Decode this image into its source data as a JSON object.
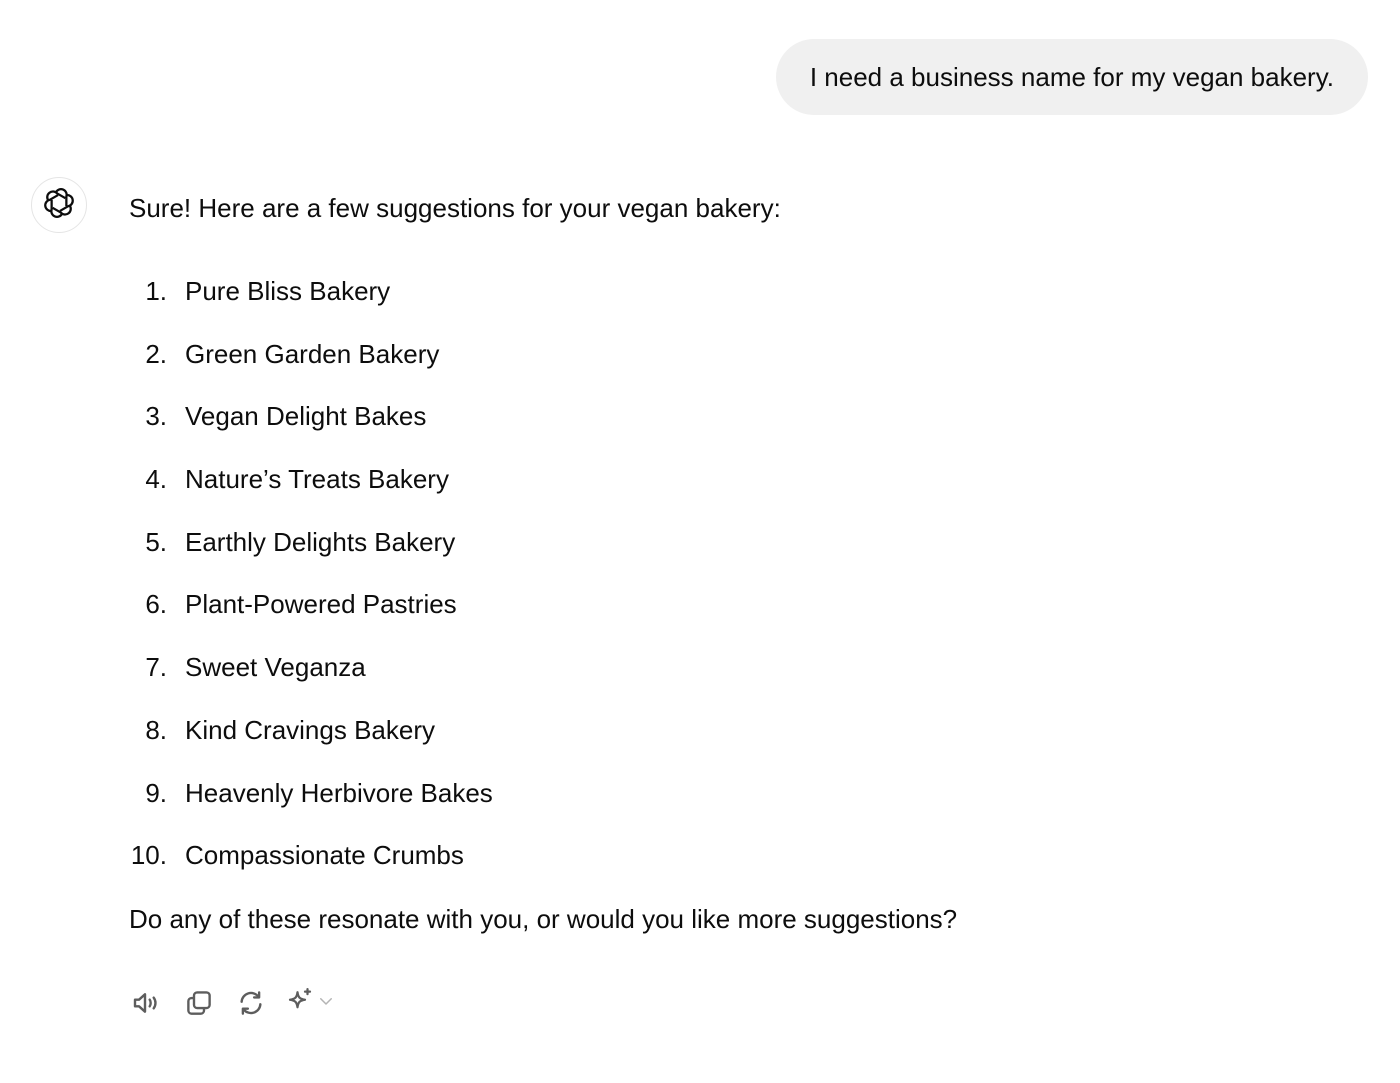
{
  "conversation": {
    "user_message": "I need a business name for my vegan bakery.",
    "assistant": {
      "avatar_icon": "openai-logo-icon",
      "intro": "Sure! Here are a few suggestions for your vegan bakery:",
      "suggestions": [
        {
          "num": "1.",
          "text": "Pure Bliss Bakery"
        },
        {
          "num": "2.",
          "text": "Green Garden Bakery"
        },
        {
          "num": "3.",
          "text": "Vegan Delight Bakes"
        },
        {
          "num": "4.",
          "text": "Nature’s Treats Bakery"
        },
        {
          "num": "5.",
          "text": "Earthly Delights Bakery"
        },
        {
          "num": "6.",
          "text": "Plant-Powered Pastries"
        },
        {
          "num": "7.",
          "text": "Sweet Veganza"
        },
        {
          "num": "8.",
          "text": "Kind Cravings Bakery"
        },
        {
          "num": "9.",
          "text": "Heavenly Herbivore Bakes"
        },
        {
          "num": "10.",
          "text": "Compassionate Crumbs"
        }
      ],
      "outro": "Do any of these resonate with you, or would you like more suggestions?"
    },
    "actions": [
      {
        "name": "read-aloud",
        "icon": "speaker-icon"
      },
      {
        "name": "copy",
        "icon": "copy-icon"
      },
      {
        "name": "regenerate",
        "icon": "refresh-icon"
      },
      {
        "name": "switch-model",
        "icon": "sparkle-icon"
      }
    ]
  },
  "colors": {
    "user_bubble": "#f0f0f0",
    "text": "#0d0d0d",
    "icon": "#5d5d5d",
    "chevron": "#b4b4b4"
  }
}
